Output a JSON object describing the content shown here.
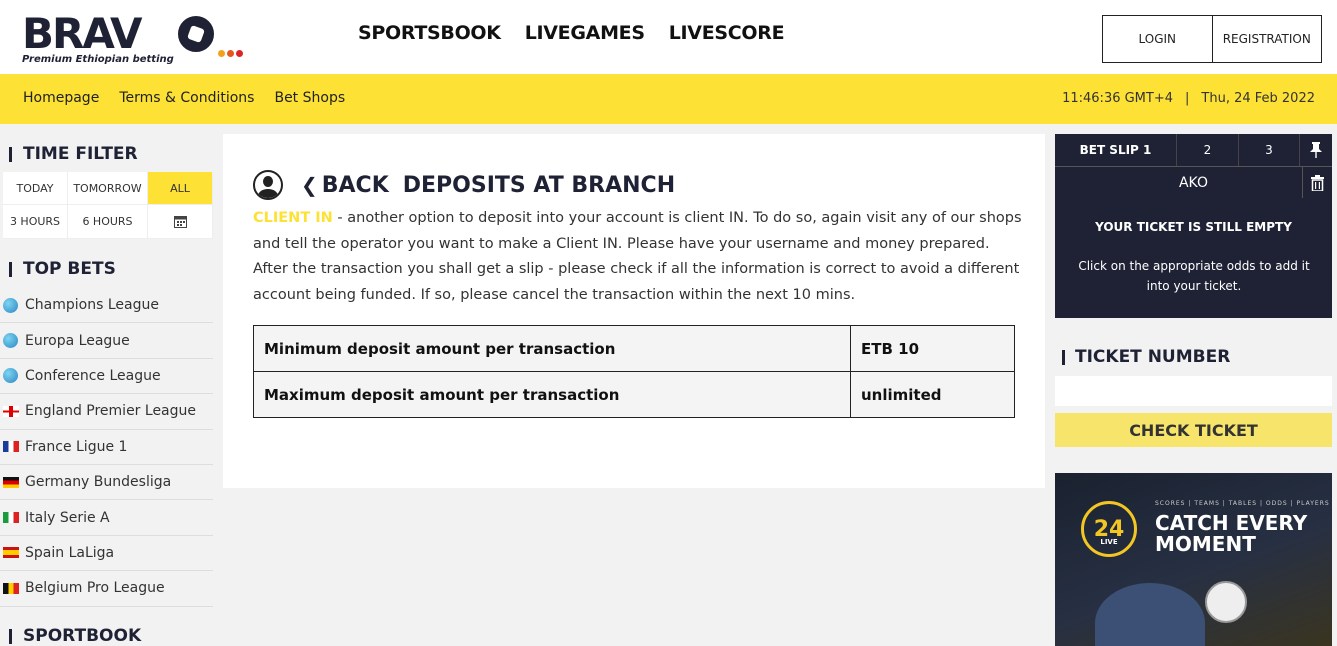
{
  "brand": {
    "logo_text": "BRAV",
    "tagline": "Premium Ethiopian betting",
    "dot_colors": [
      "#f3a11b",
      "#e8561f",
      "#d92527"
    ]
  },
  "main_nav": [
    "SPORTSBOOK",
    "LIVEGAMES",
    "LIVESCORE"
  ],
  "auth": {
    "login": "LOGIN",
    "registration": "REGISTRATION"
  },
  "sub_nav": [
    "Homepage",
    "Terms & Conditions",
    "Bet Shops"
  ],
  "clock": {
    "time": "11:46:36 GMT+4",
    "separator": "|",
    "date": "Thu, 24 Feb 2022"
  },
  "time_filter": {
    "title": "TIME FILTER",
    "options": [
      "TODAY",
      "TOMORROW",
      "ALL",
      "3 HOURS",
      "6 HOURS"
    ],
    "selected": "ALL",
    "calendar_icon": "calendar-icon"
  },
  "top_bets": {
    "title": "TOP BETS",
    "leagues": [
      {
        "name": "Champions League",
        "icon": "globe-icon"
      },
      {
        "name": "Europa League",
        "icon": "globe-icon"
      },
      {
        "name": "Conference League",
        "icon": "globe-icon"
      },
      {
        "name": "England Premier League",
        "icon": "england-flag-icon"
      },
      {
        "name": "France Ligue 1",
        "icon": "france-flag-icon"
      },
      {
        "name": "Germany Bundesliga",
        "icon": "germany-flag-icon"
      },
      {
        "name": "Italy Serie A",
        "icon": "italy-flag-icon"
      },
      {
        "name": "Spain LaLiga",
        "icon": "spain-flag-icon"
      },
      {
        "name": "Belgium Pro League",
        "icon": "belgium-flag-icon"
      }
    ]
  },
  "sportbook": {
    "title": "SPORTBOOK"
  },
  "content": {
    "back": "BACK",
    "title": "DEPOSITS AT BRANCH",
    "highlight": "CLIENT IN",
    "text": " - another option to deposit into your account is client IN. To do so, again visit any of our shops and tell the operator you want to make a Client IN. Please have your username and money prepared. After the transaction you shall get a slip - please check if all the information is correct to avoid a different account being funded. If so, please cancel the transaction within the next 10 mins.",
    "table": [
      {
        "label": "Minimum deposit amount per transaction",
        "value": "ETB 10"
      },
      {
        "label": "Maximum deposit amount per transaction",
        "value": "unlimited"
      }
    ]
  },
  "bet_slip": {
    "tabs": [
      "BET SLIP 1",
      "2",
      "3"
    ],
    "type": "AKO",
    "empty_title": "YOUR TICKET IS STILL EMPTY",
    "empty_text": "Click on the appropriate odds to add it into your ticket."
  },
  "ticket_number": {
    "title": "TICKET NUMBER",
    "input_value": "",
    "button": "CHECK TICKET"
  },
  "promo": {
    "badge": "24",
    "badge_sub": "LIVE",
    "small_text": "SCORES | TEAMS | TABLES | ODDS | PLAYERS",
    "headline": "CATCH EVERY MOMENT"
  },
  "colors": {
    "accent": "#fde135",
    "dark": "#1f2235",
    "button": "#f7e46a"
  }
}
